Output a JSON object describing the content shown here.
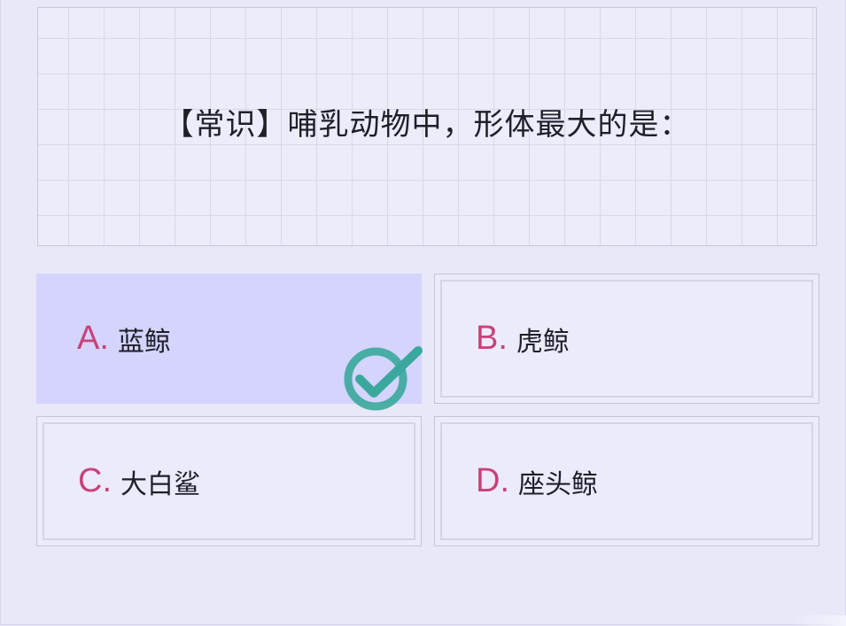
{
  "question": {
    "text": "【常识】哺乳动物中，形体最大的是："
  },
  "options": [
    {
      "letter": "A.",
      "text": "蓝鲸",
      "selected": true
    },
    {
      "letter": "B.",
      "text": "虎鲸",
      "selected": false
    },
    {
      "letter": "C.",
      "text": "大白鲨",
      "selected": false
    },
    {
      "letter": "D.",
      "text": "座头鲸",
      "selected": false
    }
  ],
  "colors": {
    "background": "#e8e8f9",
    "selected_option": "#d4d4fc",
    "letter": "#c8427a",
    "check": "#3aa89c"
  },
  "icons": {
    "correct": "check-circle-icon"
  }
}
